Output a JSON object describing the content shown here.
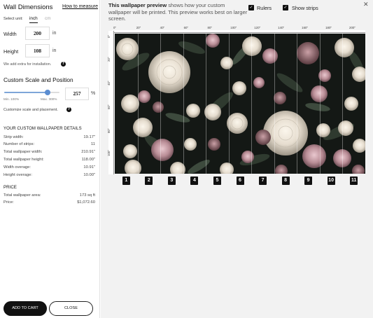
{
  "panel": {
    "title": "Wall Dimensions",
    "how_to_measure": "How to measure",
    "unit_label": "Select unit:",
    "unit_inch": "inch",
    "unit_cm": "cm",
    "width_label": "Width",
    "width_value": "200",
    "height_label": "Height",
    "height_value": "108",
    "unit_suffix": "in",
    "extra_note": "We add extra for installation.",
    "scale_title": "Custom Scale and Position",
    "scale_value": "257",
    "scale_percent": 0.787,
    "pct_sign": "%",
    "min_label": "Min. 100%",
    "max_label": "Max. 300%",
    "customize_note": "Customize scale and placement.",
    "info_glyph": "?"
  },
  "details": {
    "title": "YOUR CUSTOM WALLPAPER DETAILS",
    "rows": [
      {
        "k": "Strip width:",
        "v": "19.17\""
      },
      {
        "k": "Number of strips:",
        "v": "11"
      },
      {
        "k": "Total wallpaper width:",
        "v": "210.91\""
      },
      {
        "k": "Total wallpaper height:",
        "v": "118.00\""
      },
      {
        "k": "Width overage:",
        "v": "10.91\""
      },
      {
        "k": "Height overage:",
        "v": "10.00\""
      }
    ]
  },
  "price": {
    "title": "PRICE",
    "rows": [
      {
        "k": "Total wallpaper area:",
        "v": "173 sq ft"
      },
      {
        "k": "Price:",
        "v": "$1,072.60"
      }
    ]
  },
  "buttons": {
    "add_to_cart": "ADD TO CART",
    "close": "CLOSE"
  },
  "preview": {
    "desc_bold": "This wallpaper preview",
    "desc_rest": " shows how your custom wallpaper will be printed. This preview works best on larger screen.",
    "rulers_label": "Rulers",
    "rulers_checked": true,
    "strips_label": "Show strips",
    "strips_checked": true,
    "check_glyph": "✓",
    "close_glyph": "✕",
    "top_ruler_labels": [
      "0\"",
      "20\"",
      "40\"",
      "60\"",
      "80\"",
      "100\"",
      "120\"",
      "140\"",
      "160\"",
      "180\"",
      "200\""
    ],
    "left_ruler_labels": [
      "0\"",
      "20\"",
      "40\"",
      "60\"",
      "80\"",
      "100\""
    ],
    "strip_numbers": [
      "1",
      "2",
      "3",
      "4",
      "5",
      "6",
      "7",
      "8",
      "9",
      "10",
      "11"
    ]
  },
  "colors": {
    "accent": "#5b8dd1",
    "dark": "#111111"
  }
}
